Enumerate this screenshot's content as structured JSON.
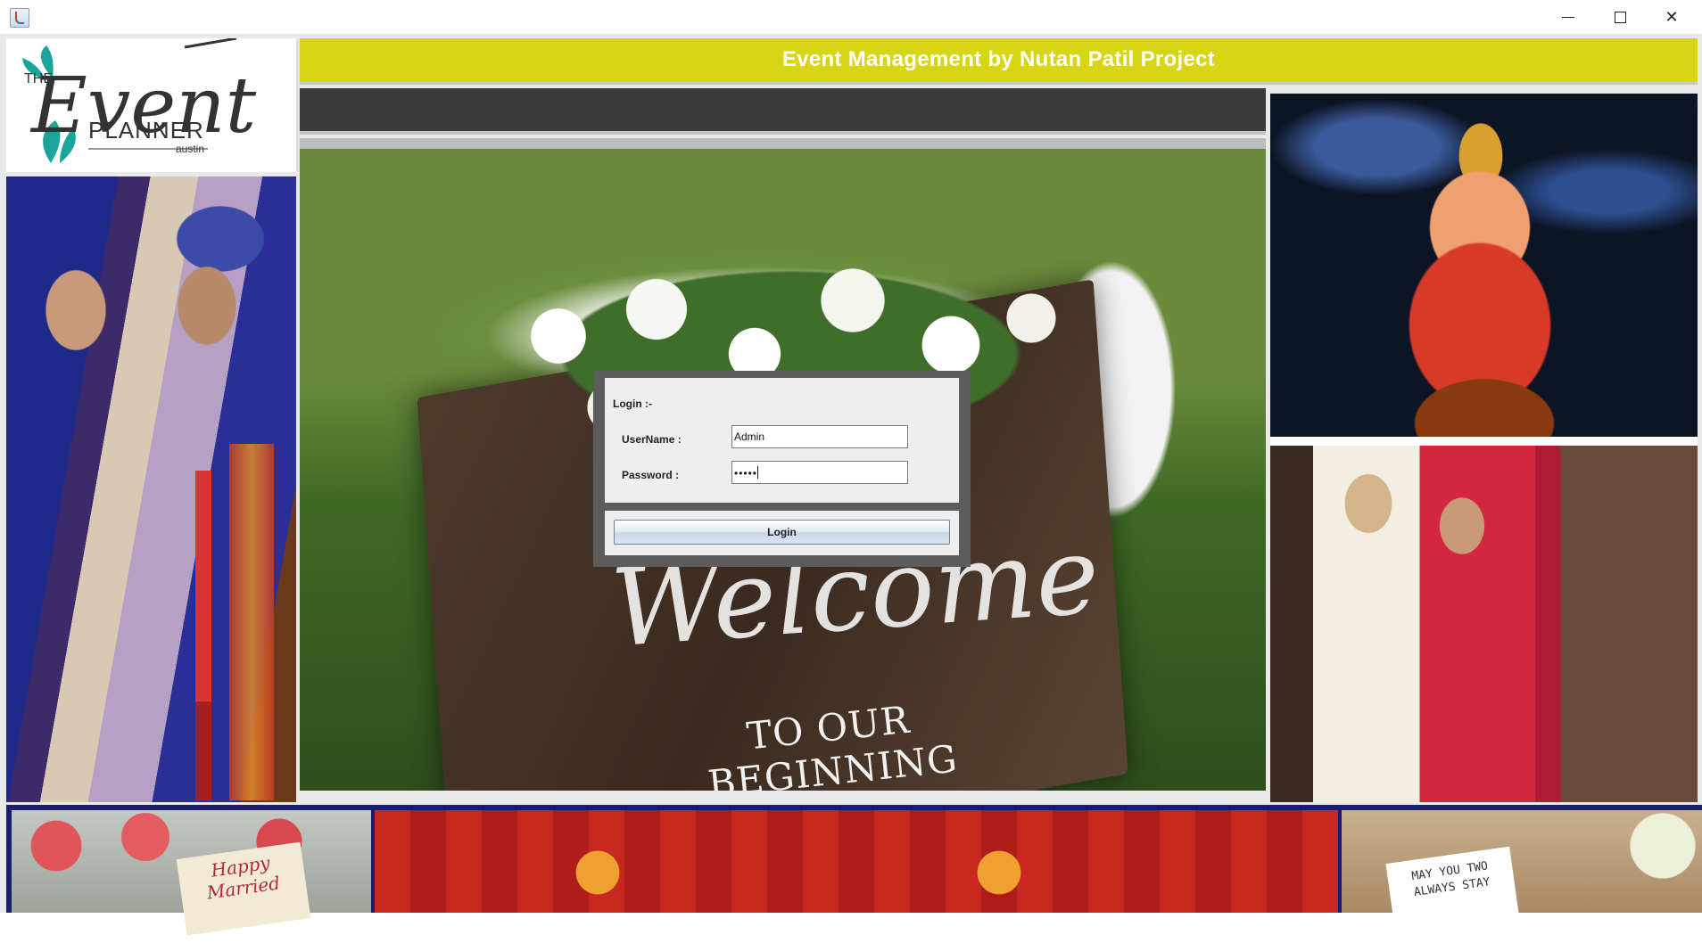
{
  "window": {
    "icon": "java-cup-icon",
    "controls": {
      "minimize": "minimize-icon",
      "maximize": "maximize-icon",
      "close": "close-icon"
    }
  },
  "logo": {
    "the": "THE",
    "event": "Event",
    "planner": "PLANNER",
    "city": "austin"
  },
  "header": {
    "title": "Event Management by Nutan Patil Project"
  },
  "welcome_photo": {
    "script_text": "Welcome",
    "subtitle": "TO OUR BEGINNING"
  },
  "bottom": {
    "tag_line1": "Happy",
    "tag_line2": "Married",
    "card_line1": "MAY YOU TWO",
    "card_line2": "ALWAYS STAY"
  },
  "login": {
    "heading": "Login :-",
    "username_label": "UserName :",
    "username_value": "Admin",
    "password_label": "Password :",
    "password_value": "•••••",
    "button_label": "Login"
  },
  "colors": {
    "header_bg": "#d8d514",
    "header_text": "#ffffff",
    "dark_bar": "#3a3a3a",
    "dialog_border": "#5c5c5c",
    "bottom_border": "#1b1d6e"
  }
}
